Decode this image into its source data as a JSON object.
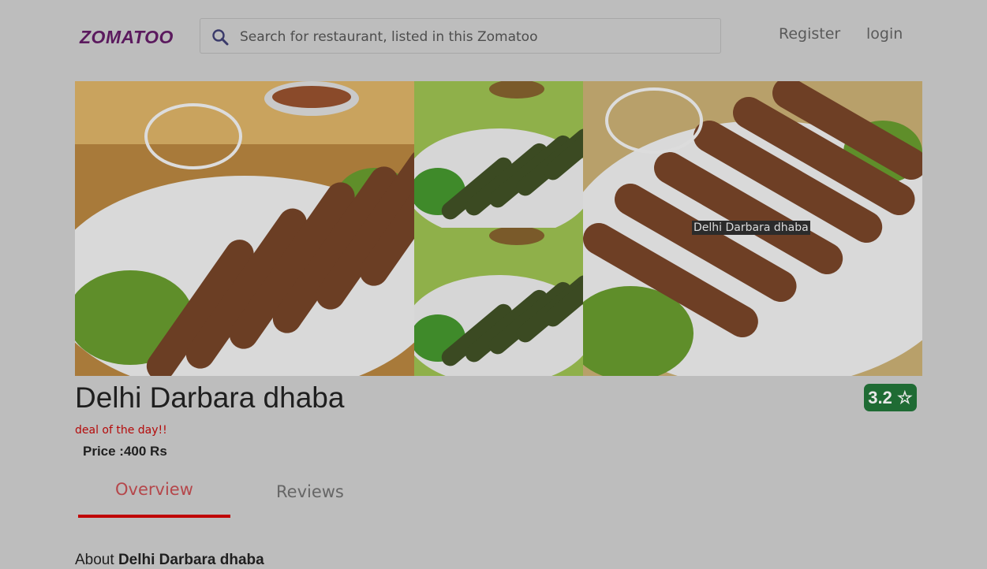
{
  "header": {
    "logo": "ZOMATOO",
    "search_placeholder": "Search for restaurant, listed in this Zomatoo",
    "register": "Register",
    "login": "login"
  },
  "gallery": {
    "tooltip": "Delhi Darbara dhaba"
  },
  "restaurant": {
    "name": "Delhi Darbara dhaba",
    "rating": "3.2 ☆",
    "deal": "deal of the day!!",
    "price": "Price :400 Rs"
  },
  "tabs": {
    "overview": "Overview",
    "reviews": "Reviews",
    "active": "Overview"
  },
  "about": {
    "prefix": "About",
    "name": "Delhi Darbara dhaba"
  },
  "colors": {
    "logo": "#5b1a5e",
    "accent": "#c00000",
    "rating_bg": "#1f6b34",
    "deal": "#b40a0a"
  }
}
